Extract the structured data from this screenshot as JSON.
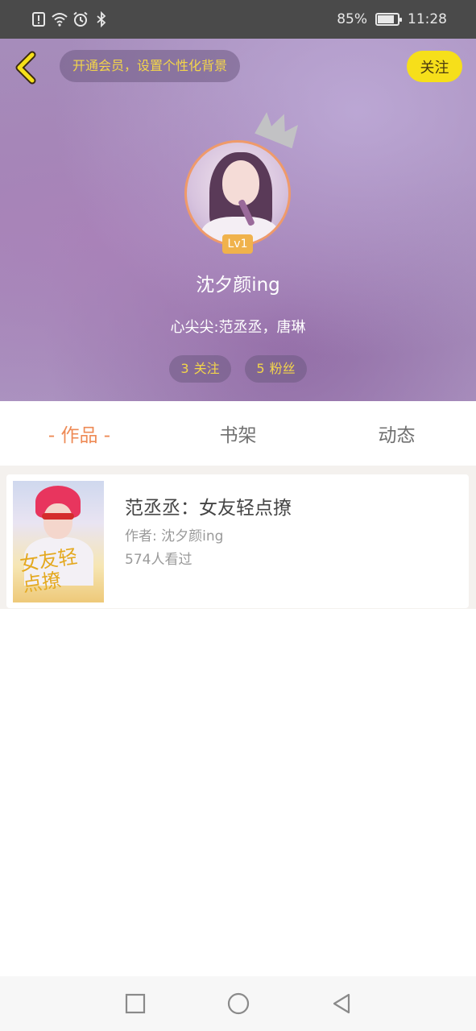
{
  "status_bar": {
    "battery_percent": "85%",
    "battery_level": 0.85,
    "time": "11:28",
    "icons": [
      "alert-icon",
      "wifi-icon",
      "alarm-icon",
      "bluetooth-icon",
      "battery-icon"
    ]
  },
  "header": {
    "back_icon": "chevron-left-icon",
    "vip_prompt": "开通会员，设置个性化背景",
    "follow_label": "关注"
  },
  "profile": {
    "crown_icon": "crown-icon",
    "level": "Lv1",
    "username": "沈夕颜ing",
    "bio": "心尖尖:范丞丞，唐琳",
    "following_count": "3",
    "following_label": "关注",
    "fans_count": "5",
    "fans_label": "粉丝"
  },
  "tabs": [
    {
      "label": "- 作品 -",
      "active": true
    },
    {
      "label": "书架",
      "active": false
    },
    {
      "label": "动态",
      "active": false
    }
  ],
  "works": [
    {
      "title": "范丞丞：女友轻点撩",
      "author": "作者: 沈夕颜ing",
      "views": "574人看过",
      "cover_text": "女友轻点撩"
    }
  ],
  "nav_bar": {
    "icons": [
      "recents-square-icon",
      "home-circle-icon",
      "back-triangle-icon"
    ]
  },
  "colors": {
    "accent_orange": "#ee8a55",
    "follow_yellow": "#f6df1a",
    "pill_text_yellow": "#f3d54a",
    "hero_purple": "#a287b6"
  }
}
